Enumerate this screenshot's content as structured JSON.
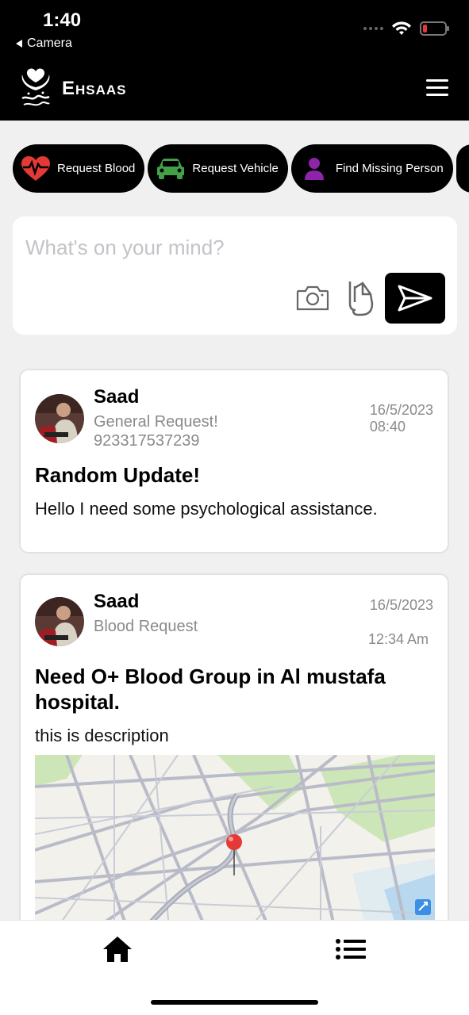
{
  "status_bar": {
    "time": "1:40",
    "back_app": "Camera"
  },
  "header": {
    "brand": "Ehsaas"
  },
  "chips": [
    {
      "label": "Request Blood",
      "icon": "heartbeat-icon",
      "color": "#e53935"
    },
    {
      "label": "Request Vehicle",
      "icon": "car-icon",
      "color": "#43a047"
    },
    {
      "label": "Find Missing Person",
      "icon": "person-icon",
      "color": "#8e24aa"
    }
  ],
  "composer": {
    "placeholder": "What's on your mind?"
  },
  "posts": [
    {
      "name": "Saad",
      "type": "General Request!",
      "phone": "923317537239",
      "date": "16/5/2023",
      "time": "08:40",
      "title": "Random Update!",
      "body": "Hello I need some psychological assistance."
    },
    {
      "name": "Saad",
      "type": "Blood Request",
      "date": "16/5/2023",
      "time": "12:34 Am",
      "title": "Need O+ Blood Group in  Al mustafa hospital.",
      "body": "this is description"
    }
  ],
  "battery_level": 0.2,
  "colors": {
    "header_bg": "#000000",
    "accent": "#000000",
    "muted_text": "#8a8a8a"
  }
}
